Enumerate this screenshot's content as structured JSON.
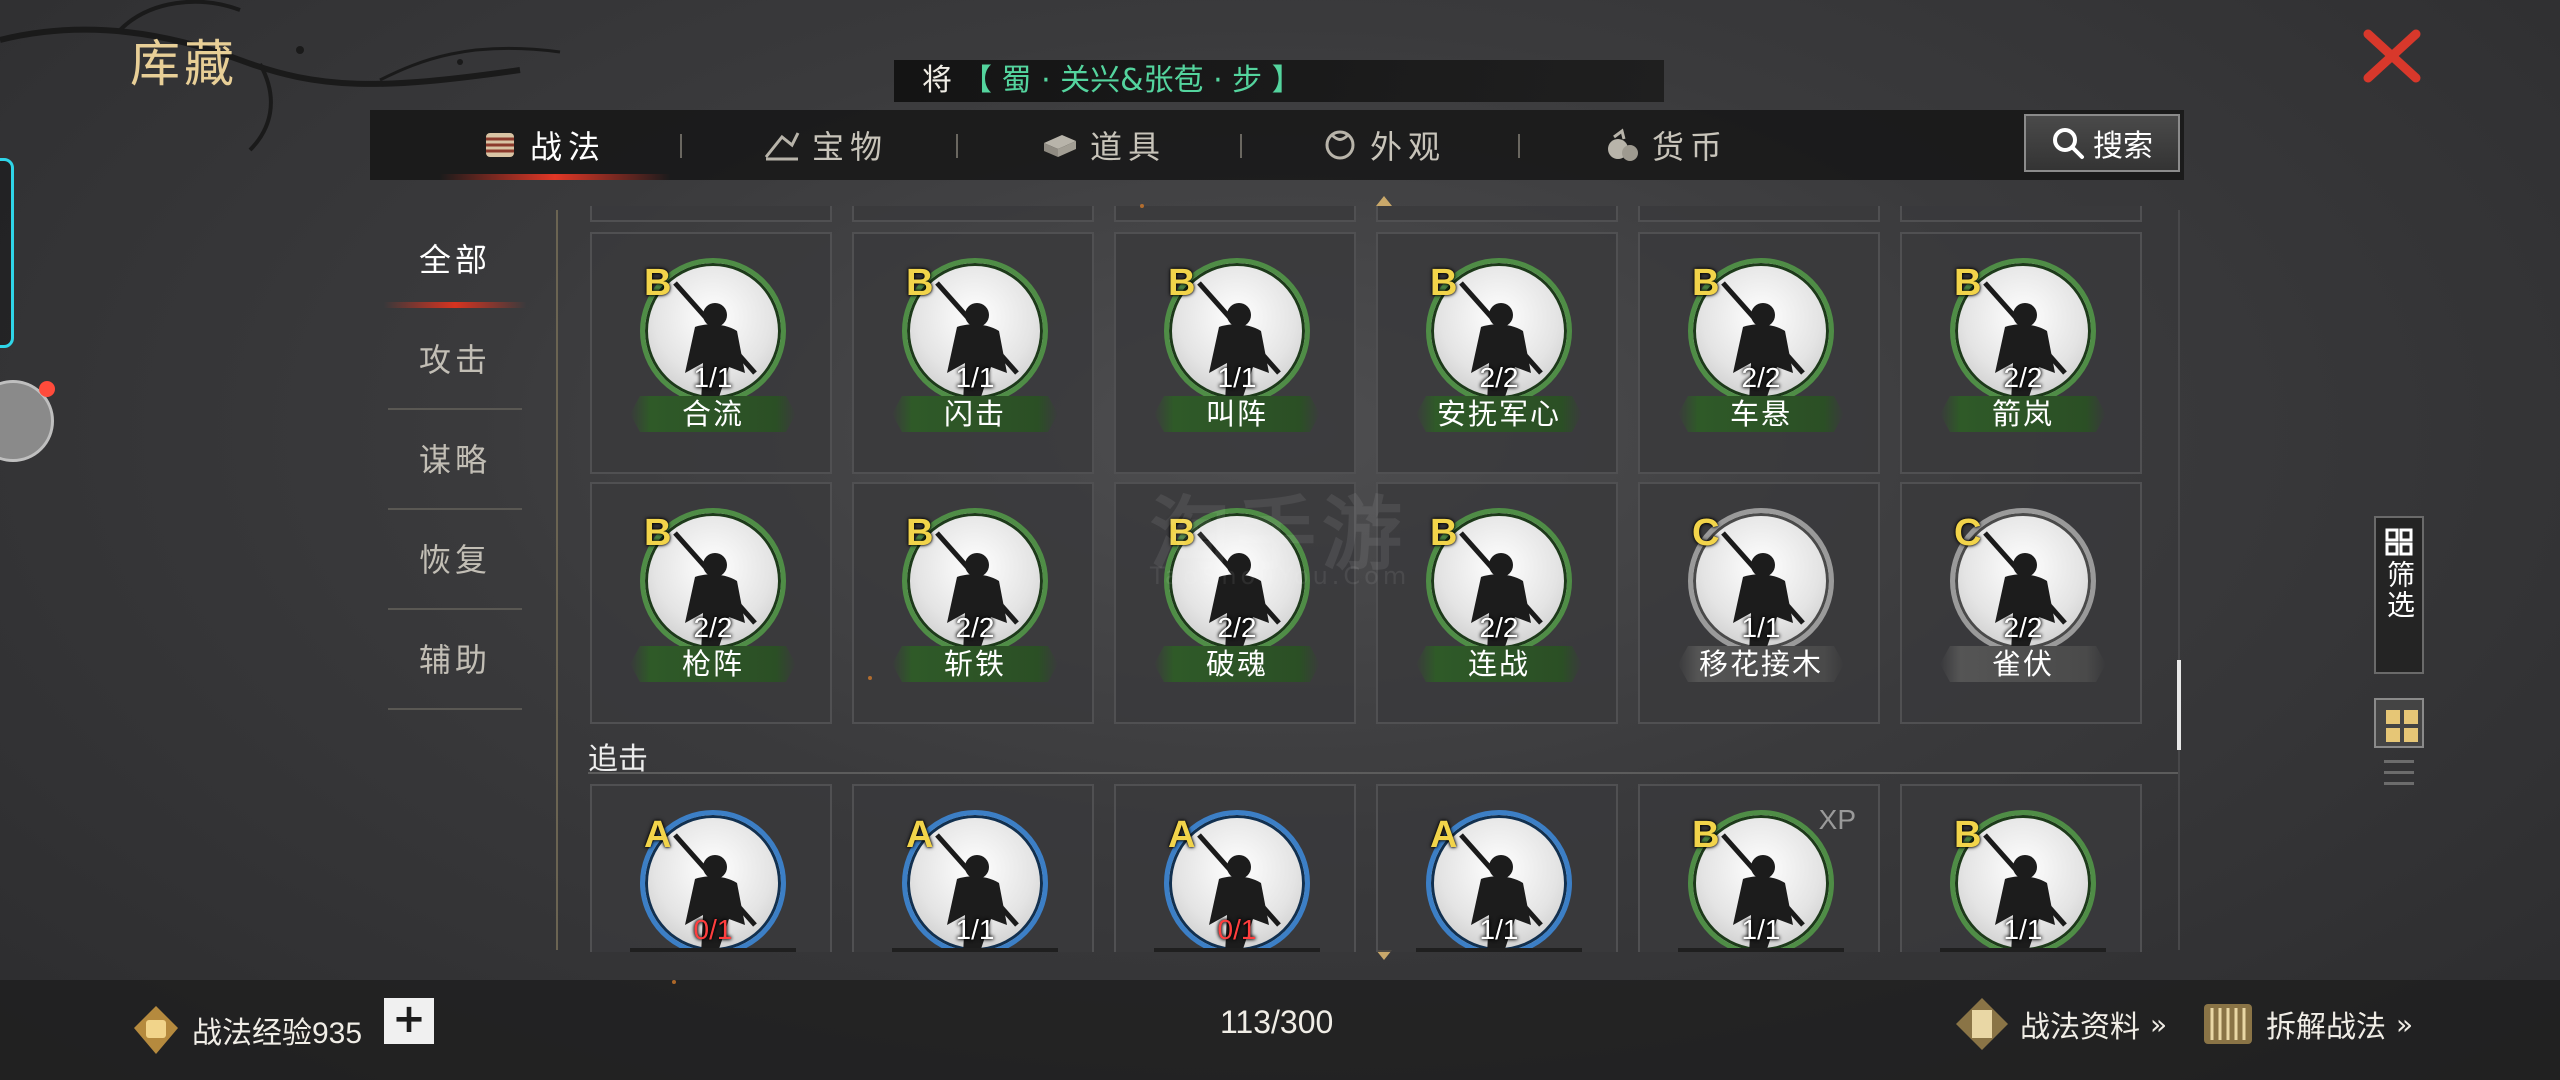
{
  "header": {
    "title": "库藏",
    "general_prefix": "将",
    "general_name": "【 蜀 · 关兴&张苞 · 步 】"
  },
  "tabs": [
    {
      "label": "战法",
      "icon": "scroll-bundle-icon",
      "active": true
    },
    {
      "label": "宝物",
      "icon": "treasure-icon",
      "active": false
    },
    {
      "label": "道具",
      "icon": "item-box-icon",
      "active": false
    },
    {
      "label": "外观",
      "icon": "appearance-icon",
      "active": false
    },
    {
      "label": "货币",
      "icon": "money-bag-icon",
      "active": false
    }
  ],
  "search": {
    "label": "搜索"
  },
  "categories": [
    {
      "label": "全部",
      "active": true
    },
    {
      "label": "攻击",
      "active": false
    },
    {
      "label": "谋略",
      "active": false
    },
    {
      "label": "恢复",
      "active": false
    },
    {
      "label": "辅助",
      "active": false
    }
  ],
  "grid": {
    "row1": [
      {
        "grade": "B",
        "count": "1/1",
        "name": "合流",
        "ring": "green"
      },
      {
        "grade": "B",
        "count": "1/1",
        "name": "闪击",
        "ring": "green"
      },
      {
        "grade": "B",
        "count": "1/1",
        "name": "叫阵",
        "ring": "green"
      },
      {
        "grade": "B",
        "count": "2/2",
        "name": "安抚军心",
        "ring": "green"
      },
      {
        "grade": "B",
        "count": "2/2",
        "name": "车悬",
        "ring": "green"
      },
      {
        "grade": "B",
        "count": "2/2",
        "name": "箭岚",
        "ring": "green"
      }
    ],
    "row2": [
      {
        "grade": "B",
        "count": "2/2",
        "name": "枪阵",
        "ring": "green"
      },
      {
        "grade": "B",
        "count": "2/2",
        "name": "斩铁",
        "ring": "green"
      },
      {
        "grade": "B",
        "count": "2/2",
        "name": "破魂",
        "ring": "green"
      },
      {
        "grade": "B",
        "count": "2/2",
        "name": "连战",
        "ring": "green"
      },
      {
        "grade": "C",
        "count": "1/1",
        "name": "移花接木",
        "ring": "grey"
      },
      {
        "grade": "C",
        "count": "2/2",
        "name": "雀伏",
        "ring": "grey"
      }
    ],
    "section_title": "追击",
    "row3": [
      {
        "grade": "A",
        "count": "0/1",
        "ring": "blue",
        "count_red": true
      },
      {
        "grade": "A",
        "count": "1/1",
        "ring": "blue",
        "count_red": false
      },
      {
        "grade": "A",
        "count": "0/1",
        "ring": "blue",
        "count_red": true
      },
      {
        "grade": "A",
        "count": "1/1",
        "ring": "blue",
        "count_red": false
      },
      {
        "grade": "B",
        "count": "1/1",
        "ring": "green",
        "count_red": false,
        "badge": "XP"
      },
      {
        "grade": "B",
        "count": "1/1",
        "ring": "green",
        "count_red": false
      }
    ]
  },
  "watermark": {
    "text": "淘手游",
    "sub": "TaoShouYou.Com"
  },
  "side": {
    "filter_label": "筛选"
  },
  "footer": {
    "exp_label": "战法经验935",
    "plus": "+",
    "capacity": "113/300",
    "info_link": "战法资料",
    "dismantle_link": "拆解战法",
    "chevrons": "»"
  },
  "colors": {
    "accent_red": "#e13726",
    "gold": "#e8cf97",
    "general_green": "#54d49e",
    "grade_yellow": "#f2d44a"
  }
}
